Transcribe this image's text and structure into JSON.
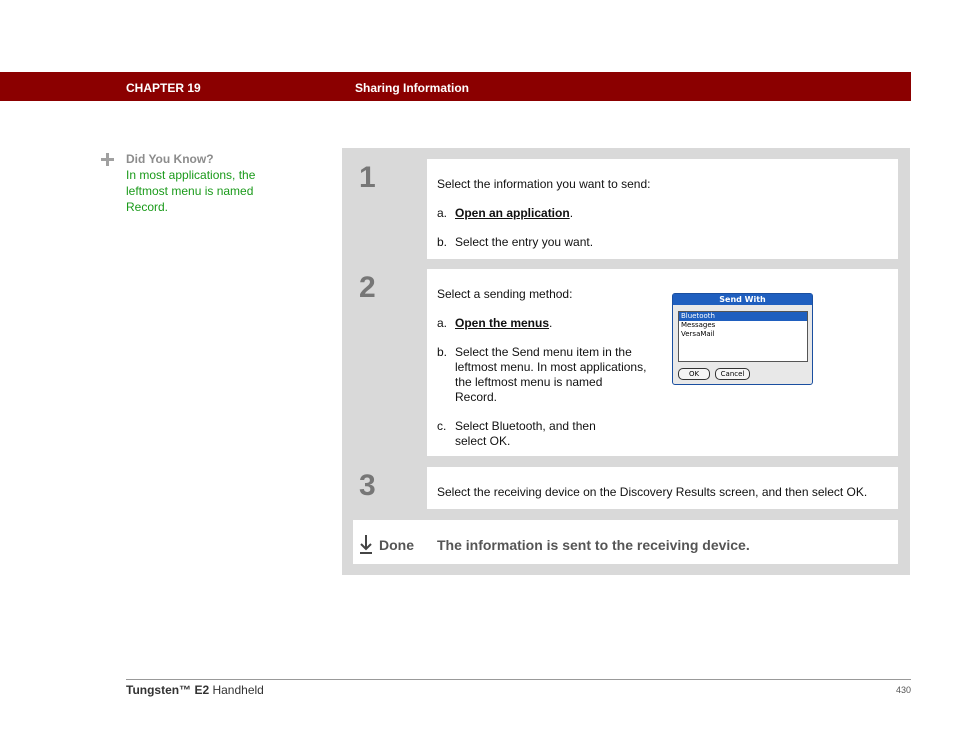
{
  "header": {
    "chapter": "CHAPTER 19",
    "section": "Sharing Information"
  },
  "tip": {
    "icon": "plus-icon",
    "title": "Did You Know?",
    "body": "In most applications, the leftmost menu is named Record."
  },
  "steps": [
    {
      "number": "1",
      "intro": "Select the information you want to send:",
      "items": [
        {
          "label": "a.",
          "link": "Open an application",
          "suffix": "."
        },
        {
          "label": "b.",
          "text": "Select the entry you want."
        }
      ]
    },
    {
      "number": "2",
      "intro": "Select a sending method:",
      "items": [
        {
          "label": "a.",
          "link": "Open the menus",
          "suffix": "."
        },
        {
          "label": "b.",
          "text": "Select the Send menu item in the leftmost menu. In most applications, the leftmost menu is named Record."
        },
        {
          "label": "c.",
          "text": "Select Bluetooth, and then select OK."
        }
      ]
    },
    {
      "number": "3",
      "text": "Select the receiving device on the Discovery Results screen, and then select OK."
    }
  ],
  "dialog": {
    "title": "Send With",
    "options": [
      "Bluetooth",
      "Messages",
      "VersaMail"
    ],
    "selected": "Bluetooth",
    "ok_label": "OK",
    "cancel_label": "Cancel"
  },
  "done": {
    "icon": "down-arrow-icon",
    "label": "Done",
    "text": "The information is sent to the receiving device."
  },
  "footer": {
    "product_name": "Tungsten™ E2",
    "product_suffix": " Handheld",
    "page_number": "430"
  },
  "colors": {
    "header_bg": "#8b0000",
    "tip_text": "#1a9a1a",
    "panel_bg": "#d9d9d9"
  }
}
